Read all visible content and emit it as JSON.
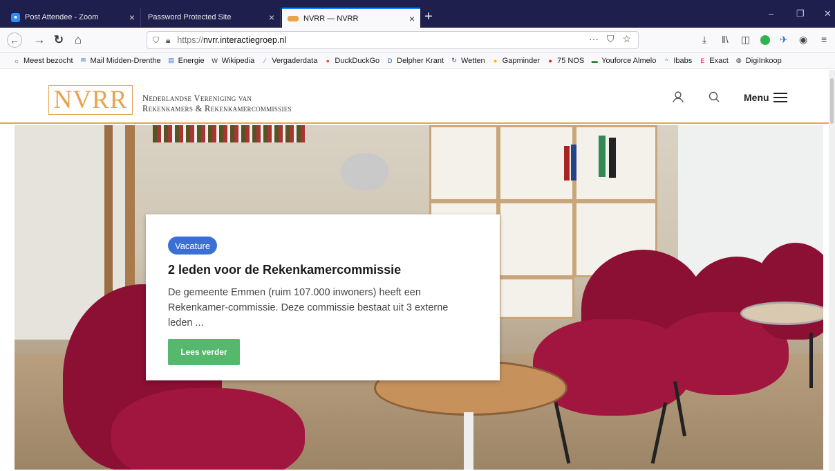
{
  "tabs": [
    {
      "title": "Post Attendee - Zoom",
      "favicon_color": "#2d8cff",
      "active": false
    },
    {
      "title": "Password Protected Site",
      "favicon_color": "",
      "active": false
    },
    {
      "title": "NVRR — NVRR",
      "favicon_color": "#e8a34a",
      "active": true
    }
  ],
  "tab_close_glyph": "×",
  "new_tab_glyph": "+",
  "window_controls": {
    "minimize": "–",
    "restore": "❐",
    "close": "✕"
  },
  "nav": {
    "url_scheme": "https://",
    "url_host": "nvrr.interactiegroep.nl",
    "url_path": "",
    "page_actions": [
      "···",
      "⛉",
      "☆"
    ]
  },
  "bookmarks": [
    {
      "label": "Meest bezocht",
      "icon": "gear-icon",
      "color": "#555"
    },
    {
      "label": "Mail Midden-Drenthe",
      "icon": "mail-icon",
      "color": "#2a6ed3"
    },
    {
      "label": "Energie",
      "icon": "energy-icon",
      "color": "#2a6ed3"
    },
    {
      "label": "Wikipedia",
      "icon": "wikipedia-icon",
      "color": "#333"
    },
    {
      "label": "Vergaderdata",
      "icon": "vergaderdata-icon",
      "color": "#d9532c"
    },
    {
      "label": "DuckDuckGo",
      "icon": "duckduckgo-icon",
      "color": "#de5833"
    },
    {
      "label": "Delpher Krant",
      "icon": "delpher-icon",
      "color": "#1a5aa8"
    },
    {
      "label": "Wetten",
      "icon": "wetten-icon",
      "color": "#154273"
    },
    {
      "label": "Gapminder",
      "icon": "gapminder-icon",
      "color": "#ffb000"
    },
    {
      "label": "75 NOS",
      "icon": "nos-icon",
      "color": "#e61e14"
    },
    {
      "label": "Youforce Almelo",
      "icon": "youforce-icon",
      "color": "#2e7d32"
    },
    {
      "label": "Ibabs",
      "icon": "ibabs-icon",
      "color": "#43a047"
    },
    {
      "label": "Exact",
      "icon": "exact-icon",
      "color": "#e02020"
    },
    {
      "label": "DigiInkoop",
      "icon": "globe-icon",
      "color": "#333"
    }
  ],
  "site": {
    "logo_text": "NVRR",
    "org_line1": "Nederlandse Vereniging van",
    "org_line2": "Rekenkamers & Rekenkamercommissies",
    "menu_label": "Menu",
    "accent": "#e8a34a"
  },
  "card": {
    "badge": "Vacature",
    "title": "2 leden voor de Rekenkamercommissie",
    "text": "De gemeente Emmen (ruim 107.000 inwoners) heeft een Rekenkamer-commissie. Deze commissie bestaat uit 3 externe leden ...",
    "button": "Lees verder",
    "badge_color": "#3b6fd6",
    "button_color": "#55b86c"
  }
}
